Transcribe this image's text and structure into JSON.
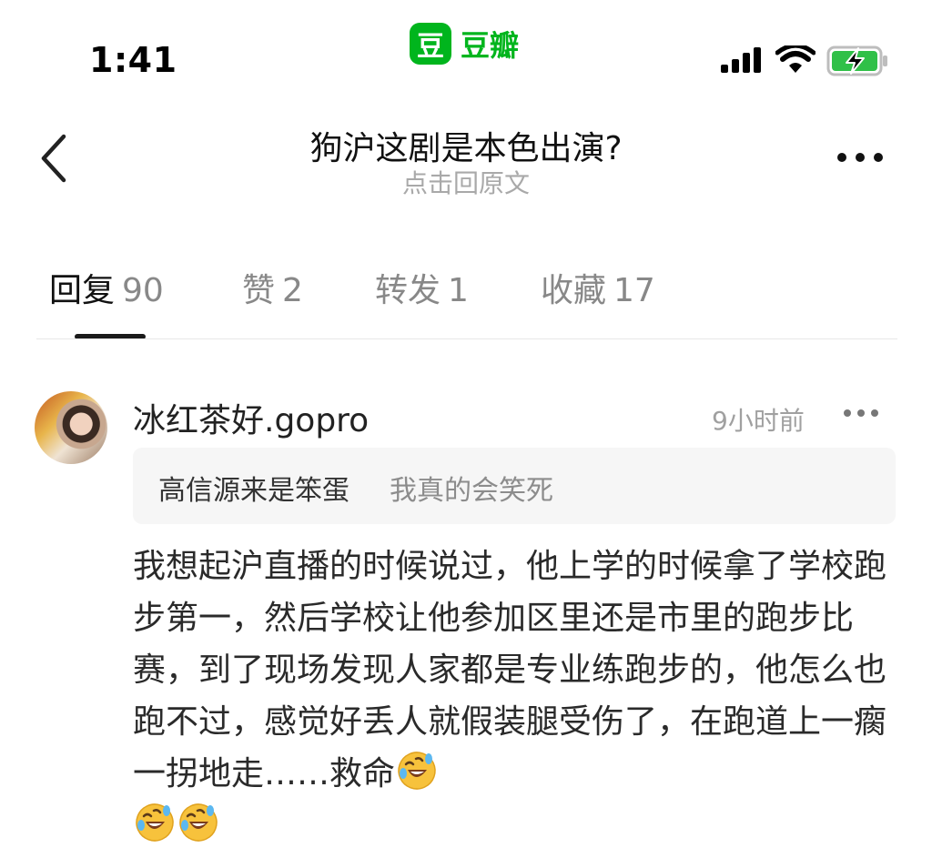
{
  "status_bar": {
    "time": "1:41",
    "app_logo_glyph": "豆",
    "app_name": "豆瓣",
    "brand_color": "#00b51d",
    "icons": [
      "signal-icon",
      "wifi-icon",
      "battery-charging-icon"
    ]
  },
  "nav": {
    "title": "狗沪这剧是本色出演?",
    "subtitle": "点击回原文",
    "back_icon": "chevron-left-icon",
    "more_icon": "more-horizontal-icon"
  },
  "tabs": [
    {
      "label": "回复",
      "count": "90",
      "active": true
    },
    {
      "label": "赞",
      "count": "2",
      "active": false
    },
    {
      "label": "转发",
      "count": "1",
      "active": false
    },
    {
      "label": "收藏",
      "count": "17",
      "active": false
    }
  ],
  "comment": {
    "username": "冰红茶好.gopro",
    "time": "9小时前",
    "quote": {
      "author": "高信源来是笨蛋",
      "text": "我真的会笑死"
    },
    "body_text": "我想起沪直播的时候说过，他上学的时候拿了学校跑步第一，然后学校让他参加区里还是市里的跑步比赛，到了现场发现人家都是专业练跑步的，他怎么也跑不过，感觉好丢人就假装腿受伤了，在跑道上一瘸一拐地走……救命",
    "emoji": [
      "rofl-emoji",
      "rofl-emoji",
      "rofl-emoji"
    ]
  }
}
